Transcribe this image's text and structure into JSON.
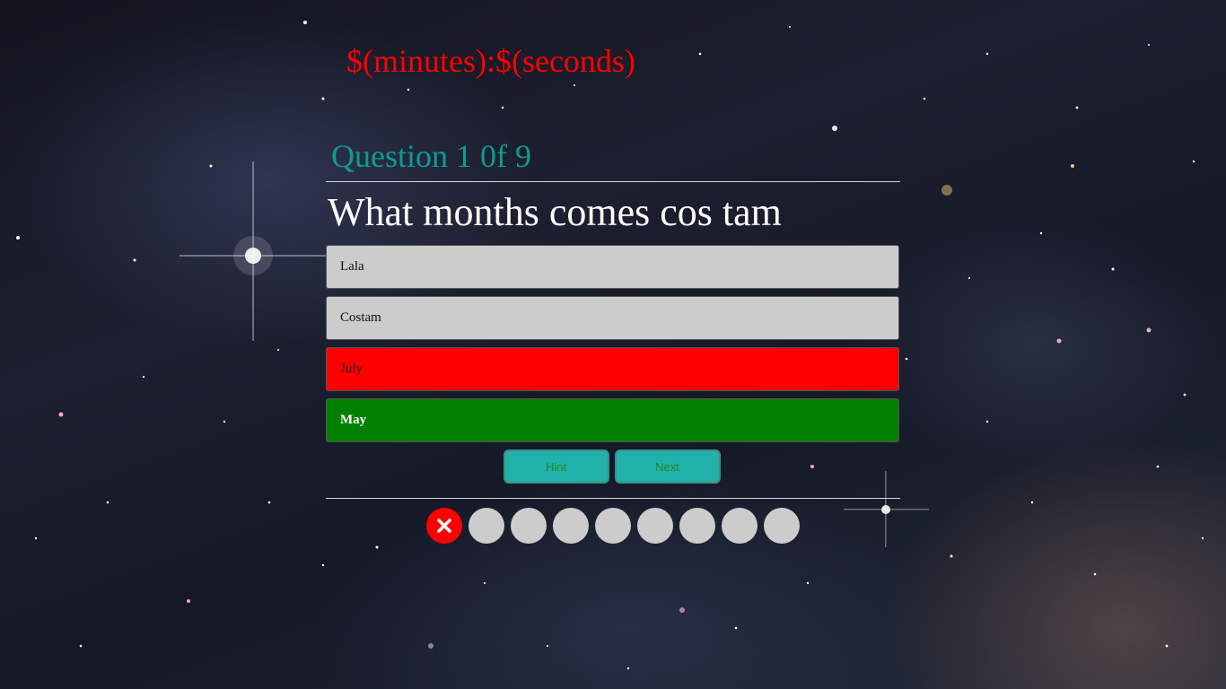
{
  "timer": {
    "text": "$(minutes):$(seconds)"
  },
  "quiz": {
    "counter": "Question 1 0f 9",
    "question": "What months comes cos tam",
    "answers": [
      {
        "label": "Lala",
        "state": "neutral"
      },
      {
        "label": "Costam",
        "state": "neutral"
      },
      {
        "label": "July",
        "state": "wrong"
      },
      {
        "label": "May",
        "state": "correct"
      }
    ],
    "hint_label": "Hint",
    "next_label": "Next"
  },
  "progress": {
    "states": [
      "wrong",
      "pending",
      "pending",
      "pending",
      "pending",
      "pending",
      "pending",
      "pending",
      "pending"
    ]
  },
  "colors": {
    "timer": "#ff0000",
    "counter": "#0f9b8e",
    "answer_neutral": "#cccccc",
    "answer_wrong": "#ff0000",
    "answer_correct": "#008000",
    "button": "#20b2aa",
    "progress_pending": "#cccccc",
    "progress_wrong": "#ff0000"
  },
  "icons": {
    "wrong_marker": "x-mark-icon"
  }
}
